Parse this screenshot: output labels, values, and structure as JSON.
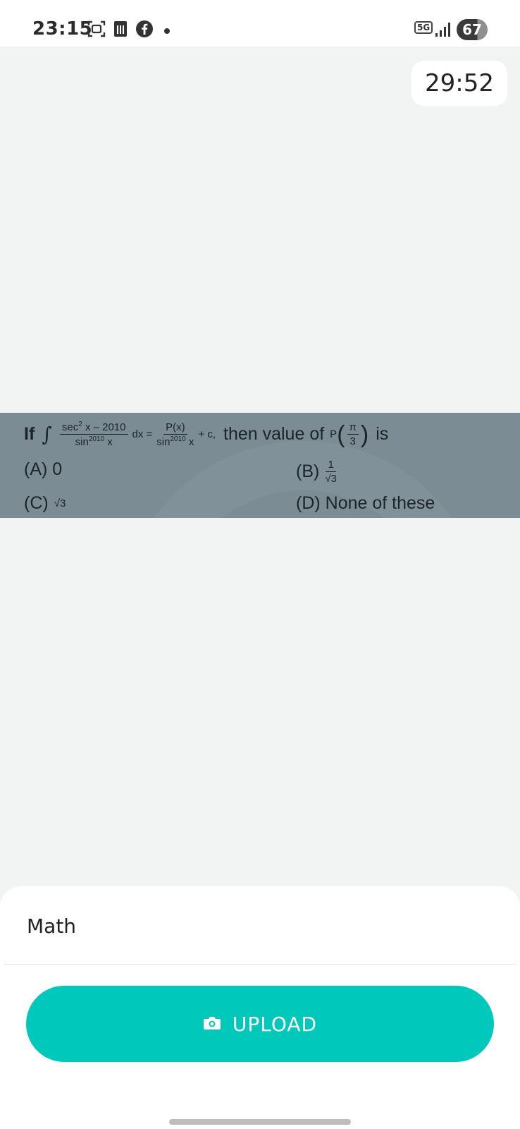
{
  "status_bar": {
    "time": "23:15",
    "network": "5G",
    "battery": "67",
    "icons": [
      "screenshot-icon",
      "sim-card-icon",
      "facebook-icon",
      "notification-dot-icon",
      "signal-icon",
      "battery-icon"
    ]
  },
  "timer": {
    "value": "29:52"
  },
  "question": {
    "if": "If",
    "integral": "∫",
    "num_sec": "sec",
    "sup_2": "2",
    "num_rest": " x – 2010",
    "den_sin": "sin",
    "sup_2010": "2010",
    "den_x": " x",
    "dx_eq": "dx =",
    "rhs_num": "P(x)",
    "plus_c": "+ c,",
    "then_text": "then value of",
    "p_label": "P",
    "pi_label": "π",
    "three_label": "3",
    "is_text": "is",
    "options": {
      "a": "(A) 0",
      "b": "(B)",
      "b_num": "1",
      "b_den": "√3",
      "c": "(C)",
      "c_val": "√3",
      "d": "(D) None of these"
    }
  },
  "bottom_sheet": {
    "subject": "Math",
    "upload_label": "UPLOAD"
  },
  "colors": {
    "accent": "#00c8ba",
    "question_bg": "#7b8c95",
    "page_bg": "#f2f3f3"
  }
}
